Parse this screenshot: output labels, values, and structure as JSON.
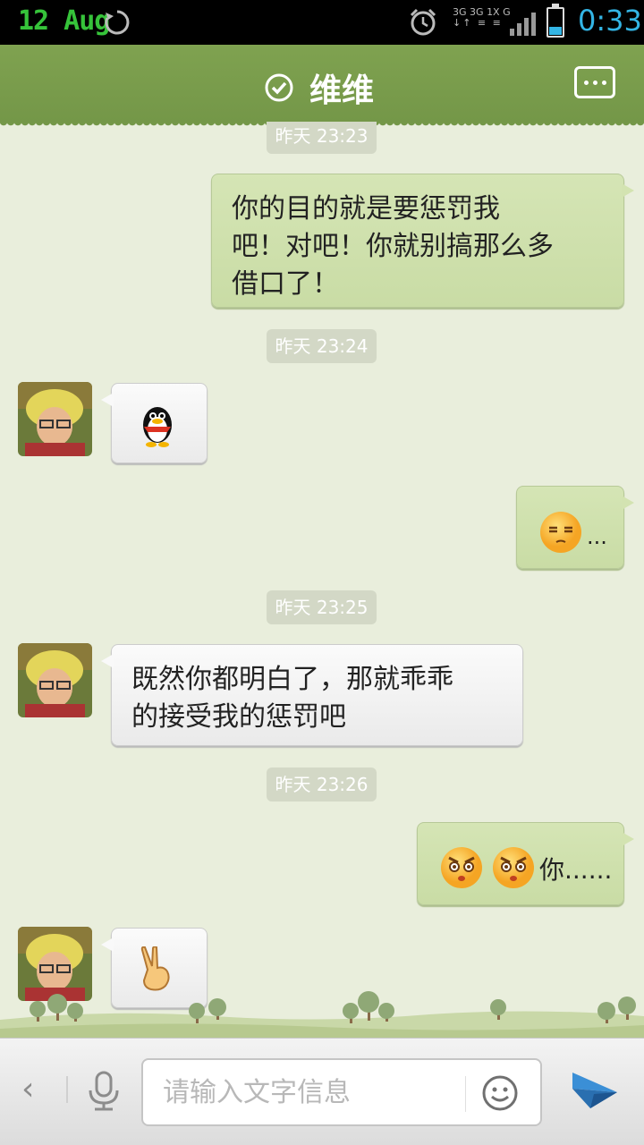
{
  "status_bar": {
    "date": "12 Aug",
    "network_labels": [
      "3G",
      "3G",
      "1X",
      "G"
    ],
    "time": "0:33",
    "accent_color": "#33b5e5"
  },
  "title_bar": {
    "title": "维维",
    "online_icon": "check-circle-icon",
    "menu_icon": "more-dots-icon"
  },
  "messages": [
    {
      "type": "time",
      "text": "昨天 23:23"
    },
    {
      "type": "outgoing",
      "text": "你的目的就是要惩罚我吧！对吧！你就别搞那么多借口了！",
      "lines": [
        "你的目的就是要惩罚我",
        "吧！对吧！你就别搞那么多",
        "借口了！"
      ]
    },
    {
      "type": "time",
      "text": "昨天 23:24"
    },
    {
      "type": "incoming",
      "emoji": "penguin-sticker"
    },
    {
      "type": "outgoing",
      "emoji": "annoyed-face",
      "tail": "..."
    },
    {
      "type": "time",
      "text": "昨天 23:25"
    },
    {
      "type": "incoming",
      "text": "既然你都明白了，那就乖乖的接受我的惩罚吧",
      "lines": [
        "既然你都明白了，那就乖乖",
        "的接受我的惩罚吧"
      ]
    },
    {
      "type": "time",
      "text": "昨天 23:26"
    },
    {
      "type": "outgoing",
      "emoji": "angry-face-x2",
      "tail": "你......"
    },
    {
      "type": "incoming",
      "emoji": "victory-hand"
    }
  ],
  "input_bar": {
    "placeholder": "请输入文字信息",
    "value": ""
  },
  "colors": {
    "title_bg": "#7a9b4c",
    "outgoing_bubble": "#cfe0ac",
    "incoming_bubble": "#f2f2f2",
    "chat_bg": "#e9eedc",
    "send_icon": "#3b8fd6"
  }
}
